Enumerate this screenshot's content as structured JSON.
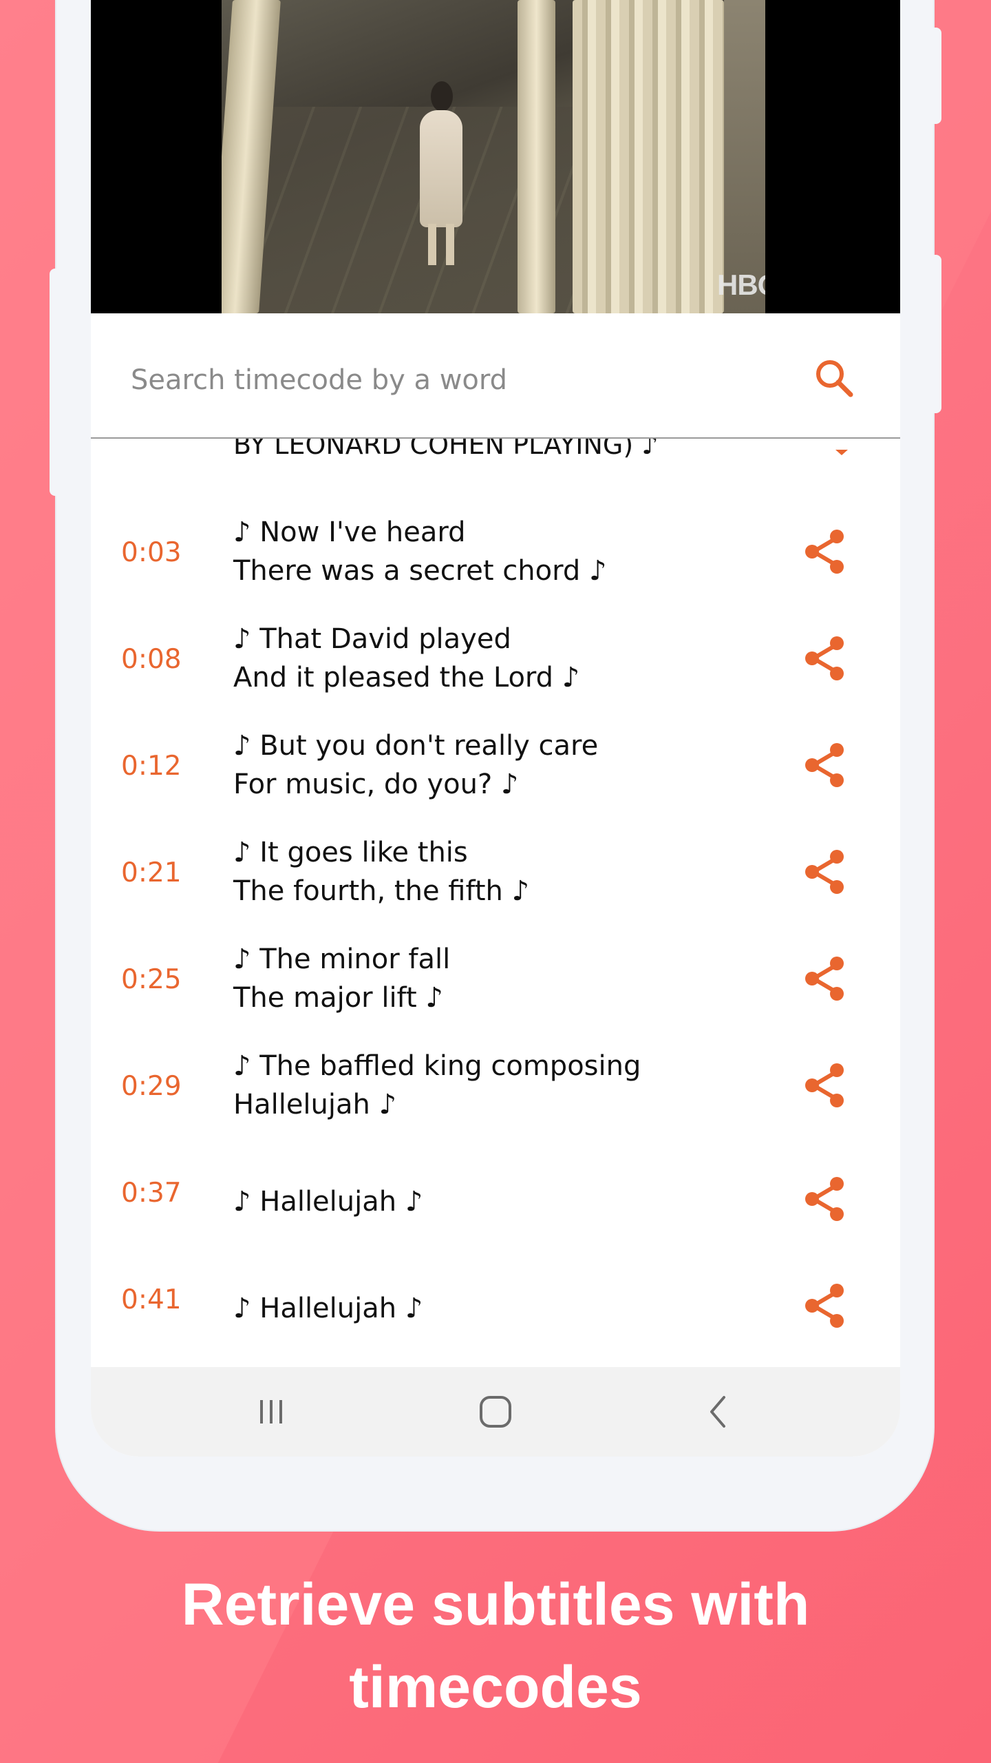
{
  "video": {
    "watermark": "HBOmax"
  },
  "search": {
    "placeholder": "Search timecode by a word"
  },
  "subtitles": {
    "partial_line": "BY LEONARD COHEN PLAYING) ♪",
    "items": [
      {
        "time": "0:03",
        "line1": "♪ Now I've heard",
        "line2": "There was a secret chord ♪"
      },
      {
        "time": "0:08",
        "line1": "♪ That David played",
        "line2": "And it pleased the Lord ♪"
      },
      {
        "time": "0:12",
        "line1": "♪ But you don't really care",
        "line2": "For music, do you? ♪"
      },
      {
        "time": "0:21",
        "line1": "♪ It goes like this",
        "line2": "The fourth, the fifth ♪"
      },
      {
        "time": "0:25",
        "line1": "♪ The minor fall",
        "line2": "The major lift ♪"
      },
      {
        "time": "0:29",
        "line1": "♪ The baffled king composing",
        "line2": "Hallelujah ♪"
      },
      {
        "time": "0:37",
        "line1": "♪ Hallelujah ♪",
        "line2": ""
      },
      {
        "time": "0:41",
        "line1": "♪ Hallelujah ♪",
        "line2": ""
      }
    ]
  },
  "colors": {
    "accent": "#e9662f",
    "background": "#fe6f7d"
  },
  "icons": {
    "search": "search-icon",
    "share": "share-icon",
    "recents": "recents-icon",
    "home": "home-icon",
    "back": "back-icon"
  },
  "caption": {
    "line1": "Retrieve subtitles with",
    "line2": "timecodes"
  }
}
